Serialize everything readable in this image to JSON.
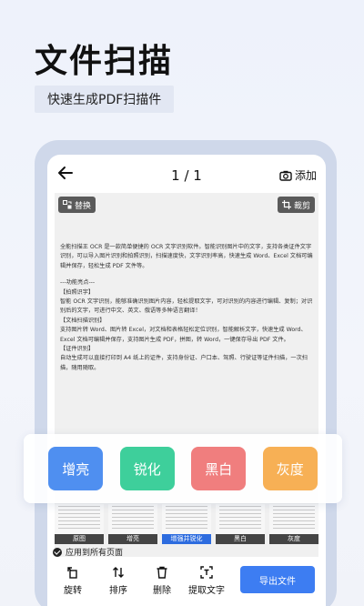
{
  "headline": "文件扫描",
  "subline": "快速生成PDF扫描件",
  "topbar": {
    "page_counter": "1 / 1",
    "add_label": "添加"
  },
  "doc_tools": {
    "replace": "替换",
    "crop": "裁剪"
  },
  "document": {
    "paragraphs": [
      "全能扫描王 OCR 是一款简单便捷的 OCR 文字识别软件。智能识别图片中的文字，支持各类证件文字识别，可以导入图片识别和拍照识别，扫描速度快，文字识别率高，快速生成 Word、Excel 文档可编辑并保存，轻松生成 PDF 文件等。",
      "---功能亮点---",
      "【拍照识字】",
      "智能 OCR 文字识别，能够准确识别图片内容，轻松提取文字，可对识别的内容进行编辑、复制；对识别后的文字，可进行中文、英文、俄语等多种语言翻译！",
      "【文档扫描识别】",
      "支持图片转 Word、图片转 Excel，对文档和表格轻松定位识别，智能解析文字，快速生成 Word、Excel 文档可编辑并保存，支持图片生成 PDF，拼图，转 Word，一键保存导出 PDF 文件。",
      "【证件识别】",
      "自动生成可以直接打印到 A4 纸上的证件，支持身份证、户口本、驾照、行驶证等证件扫描，一次扫描，随用随取。"
    ]
  },
  "filters": [
    {
      "label": "增亮",
      "color": "#4f8ff0"
    },
    {
      "label": "锐化",
      "color": "#3ecf9b"
    },
    {
      "label": "黑白",
      "color": "#f07e7e"
    },
    {
      "label": "灰度",
      "color": "#f7b055"
    }
  ],
  "thumbnails": [
    {
      "label": "原图"
    },
    {
      "label": "增亮"
    },
    {
      "label": "增强并锐化"
    },
    {
      "label": "黑白"
    },
    {
      "label": "灰度"
    }
  ],
  "apply_all": "应用到所有页面",
  "bottom_bar": {
    "rotate": "旋转",
    "sort": "排序",
    "delete": "删除",
    "extract_text": "提取文字",
    "export": "导出文件"
  }
}
